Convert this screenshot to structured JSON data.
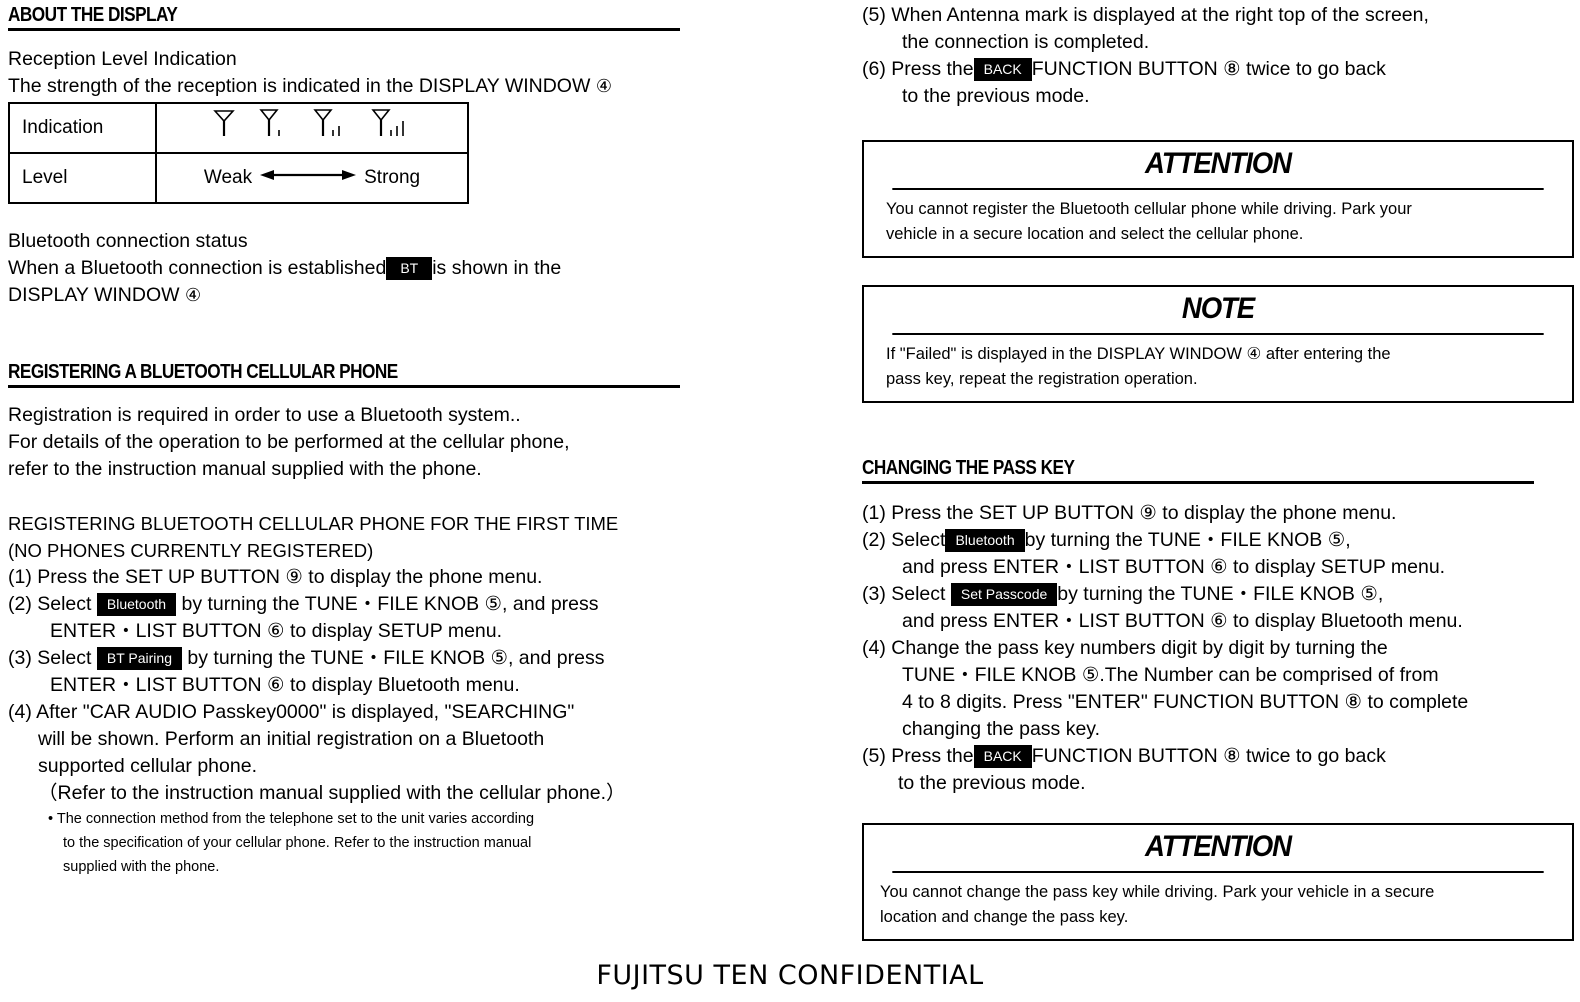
{
  "document": {
    "footer": "FUJITSU TEN CONFIDENTIAL"
  },
  "left_column": {
    "section1": {
      "heading": "ABOUT THE DISPLAY",
      "subheading": "Reception Level Indication",
      "intro_a": "The strength of the reception is indicated in the DISPLAY WINDOW ",
      "intro_circle": "④",
      "table": {
        "rows": [
          {
            "label": "Indication",
            "value_type": "antenna-icons"
          },
          {
            "label": "Level",
            "value_type": "weak-strong"
          }
        ],
        "level_weak": "Weak",
        "level_strong": "Strong",
        "antenna_bars": [
          0,
          1,
          2,
          3
        ]
      },
      "bt_status_title": "Bluetooth connection status",
      "bt_status_a": "When a Bluetooth connection is established",
      "bt_status_key": "BT",
      "bt_status_b": "is shown in the",
      "bt_status_c": "DISPLAY WINDOW ",
      "bt_status_circle": "④"
    },
    "section2": {
      "heading": "REGISTERING A BLUETOOTH CELLULAR PHONE",
      "intro": [
        "Registration is required in order to use a Bluetooth system..",
        "For details of the operation to be performed at the cellular phone,",
        "refer to the instruction manual supplied with the phone."
      ],
      "sub_title_1": "REGISTERING BLUETOOTH  CELLULAR PHONE FOR THE FIRST TIME",
      "sub_title_2": "(NO PHONES CURRENTLY REGISTERED)",
      "step1": "(1)  Press the SET UP BUTTON ⑨ to display the phone menu.",
      "step2_a": "(2)  Select",
      "step2_key": "Bluetooth",
      "step2_b": "by turning the TUNE・FILE KNOB ⑤, and press",
      "step2_c": "ENTER・LIST BUTTON ⑥ to display SETUP menu.",
      "step3_a": "(3)  Select",
      "step3_key": "BT Pairing",
      "step3_b": "by turning the TUNE・FILE KNOB ⑤, and press",
      "step3_c": "ENTER・LIST BUTTON ⑥ to display Bluetooth menu.",
      "step4_lines": [
        "(4)  After \"CAR AUDIO  Passkey0000\" is displayed, \"SEARCHING\"",
        "will be shown. Perform an initial registration on a Bluetooth",
        "supported cellular phone.",
        "（Refer to the instruction manual supplied with the cellular phone.）"
      ],
      "bullet_lines": [
        "• The connection method from the telephone set to the unit varies according",
        "to the specification of your cellular phone. Refer to the instruction manual",
        "supplied with the phone."
      ]
    }
  },
  "right_column": {
    "steps_top": {
      "step5_lines": [
        "(5)  When Antenna mark is displayed at the right top of the screen,",
        "the connection is completed."
      ],
      "step6_a": "(6)  Press the",
      "step6_key": "BACK",
      "step6_b": "FUNCTION BUTTON ⑧ twice to go back",
      "step6_c": "to the previous mode."
    },
    "attention_box_1": {
      "title": "ATTENTION",
      "lines": [
        "You cannot register the Bluetooth  cellular phone while driving. Park your",
        "vehicle  in a secure location and select the cellular phone."
      ]
    },
    "note_box": {
      "title": "NOTE",
      "lines": [
        "If \"Failed\" is displayed in the DISPLAY WINDOW  ④ after entering the",
        "pass key, repeat the registration operation."
      ]
    },
    "section3": {
      "heading": "CHANGING THE PASS KEY",
      "step1": "(1)  Press the SET UP BUTTON ⑨ to display the phone menu.",
      "step2_a": "(2)   Select",
      "step2_key": "Bluetooth",
      "step2_b": "by turning the TUNE・FILE KNOB ⑤,",
      "step2_c": "and press ENTER・LIST BUTTON ⑥ to display SETUP menu.",
      "step3_a": "(3)  Select",
      "step3_key": "Set Passcode",
      "step3_b": "by turning the TUNE・FILE KNOB ⑤,",
      "step3_c": "and press ENTER・LIST BUTTON ⑥ to display Bluetooth menu.",
      "step4_lines": [
        "(4)  Change the pass key numbers digit by digit by turning the",
        "TUNE・FILE KNOB ⑤.The Number can be comprised of from",
        "4 to 8 digits. Press \"ENTER\" FUNCTION BUTTON ⑧ to complete",
        "changing the pass key."
      ],
      "step5_a": "(5) Press the",
      "step5_key": "BACK",
      "step5_b": "FUNCTION BUTTON ⑧ twice to go back",
      "step5_c": "to the previous mode."
    },
    "attention_box_2": {
      "title": "ATTENTION",
      "lines": [
        "You cannot change the pass key while driving. Park your vehicle in a secure",
        "location and change the pass key."
      ]
    }
  }
}
